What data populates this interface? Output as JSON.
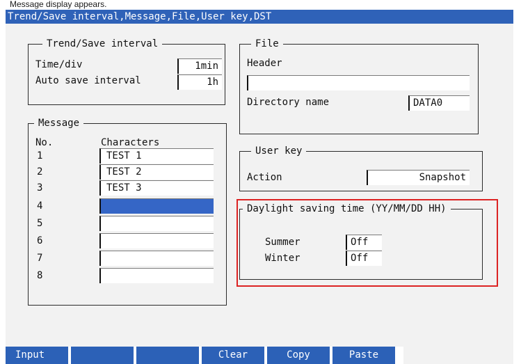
{
  "caption": "Message display appears.",
  "title": "Trend/Save interval,Message,File,User key,DST",
  "colors": {
    "titlebar": "#2f62b8",
    "softkey": "#2c61b7",
    "selected_field": "#3566c6",
    "highlight_box": "#dc2323",
    "panel_background": "#f2f2f2"
  },
  "trend_save": {
    "title": "Trend/Save interval",
    "time_div_label": "Time/div",
    "time_div_value": "1min",
    "auto_save_label": "Auto save interval",
    "auto_save_value": "1h"
  },
  "message": {
    "title": "Message",
    "no_header": "No.",
    "characters_header": "Characters",
    "rows": [
      {
        "no": "1",
        "text": "TEST 1"
      },
      {
        "no": "2",
        "text": "TEST 2"
      },
      {
        "no": "3",
        "text": "TEST 3"
      },
      {
        "no": "4",
        "text": ""
      },
      {
        "no": "5",
        "text": ""
      },
      {
        "no": "6",
        "text": ""
      },
      {
        "no": "7",
        "text": ""
      },
      {
        "no": "8",
        "text": ""
      }
    ],
    "selected_row": "4"
  },
  "file": {
    "title": "File",
    "header_label": "Header",
    "header_value": "",
    "directory_label": "Directory name",
    "directory_value": "DATA0"
  },
  "user_key": {
    "title": "User key",
    "action_label": "Action",
    "action_value": "Snapshot"
  },
  "dst": {
    "title": "Daylight saving time (YY/MM/DD HH)",
    "summer_label": "Summer",
    "summer_value": "Off",
    "winter_label": "Winter",
    "winter_value": "Off"
  },
  "softkeys": [
    "Input",
    "",
    "",
    "Clear",
    "Copy",
    "Paste"
  ]
}
